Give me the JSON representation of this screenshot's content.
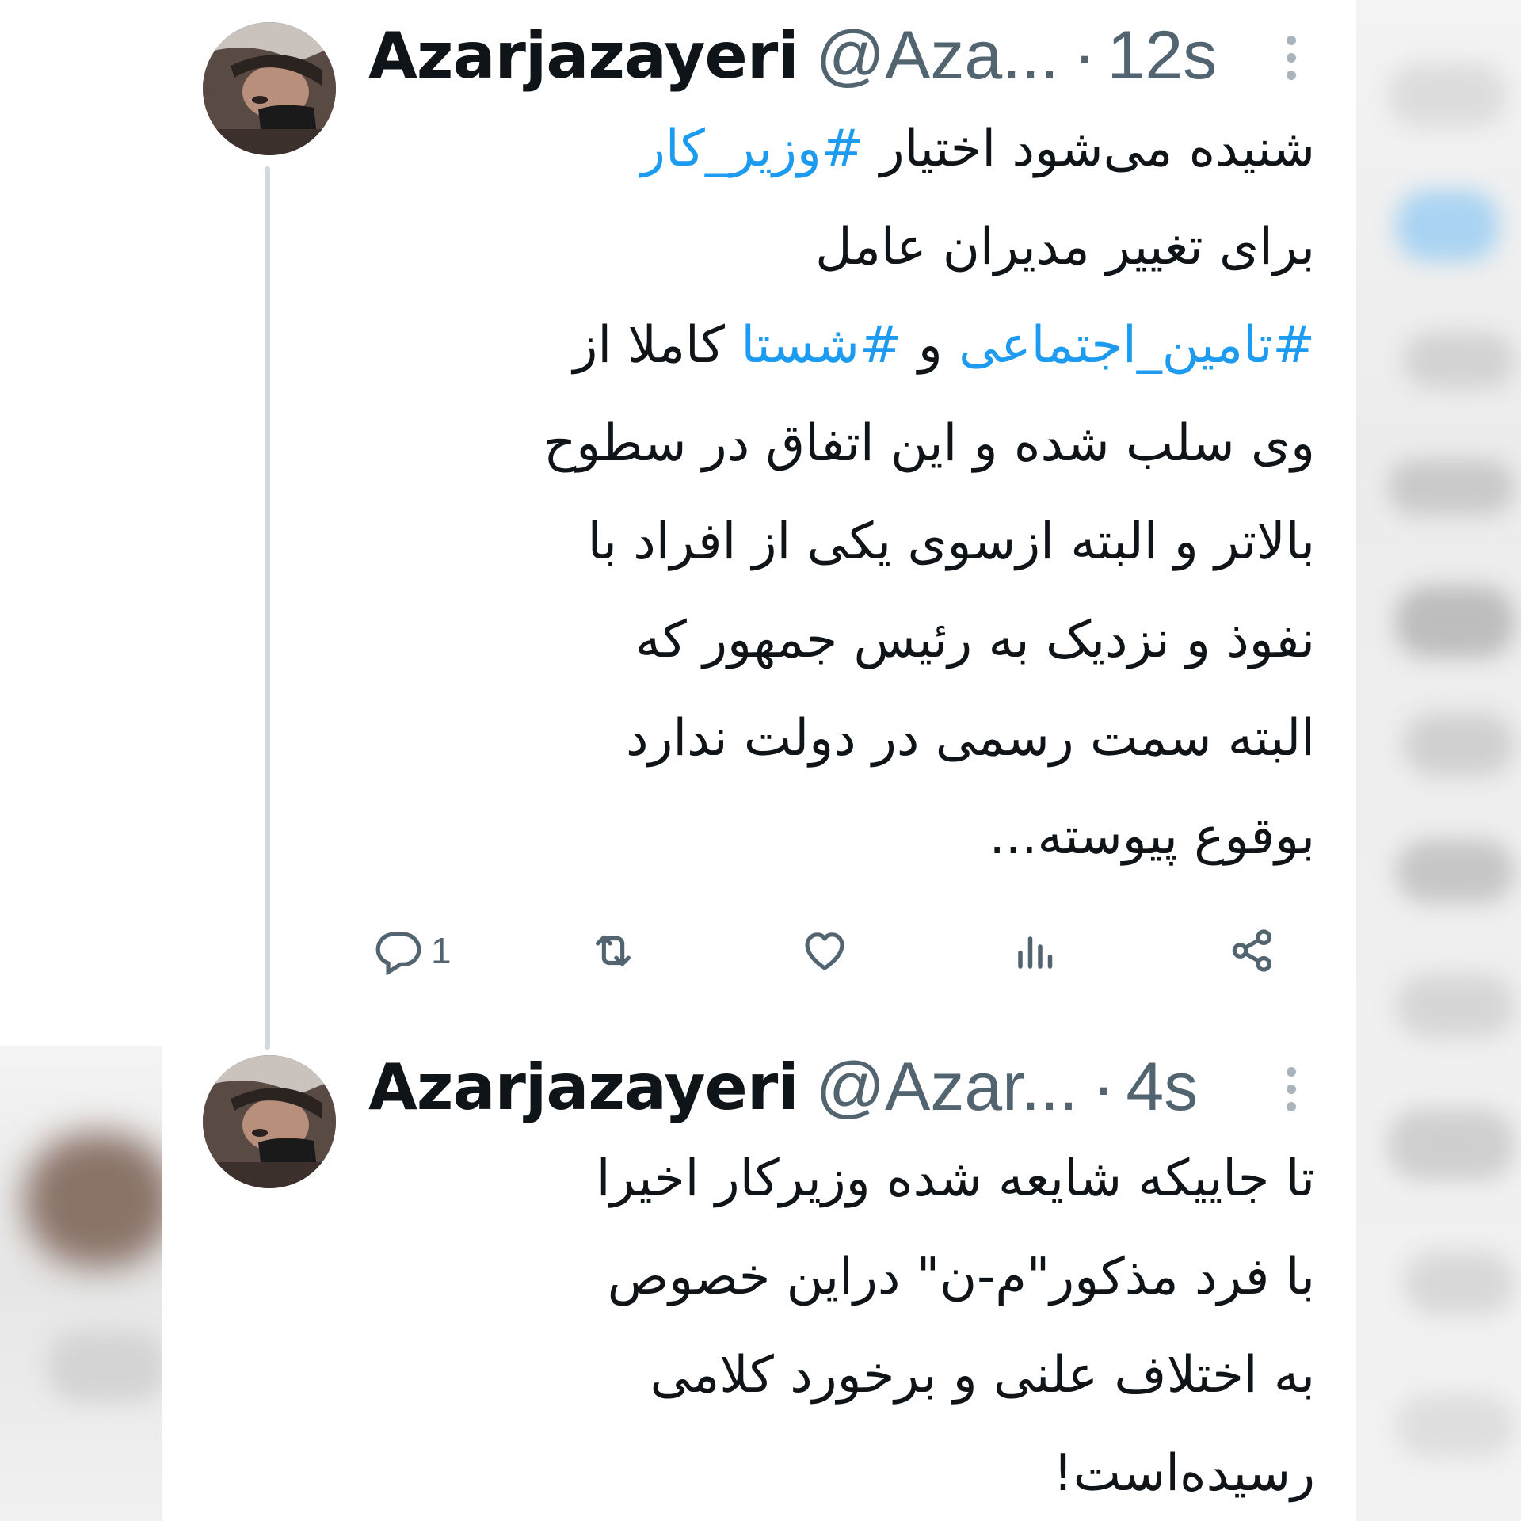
{
  "colors": {
    "text_primary": "#0f1419",
    "text_secondary": "#536471",
    "link": "#1d9bf0",
    "thread_line": "#cfd9de",
    "background": "#ffffff"
  },
  "tweets": [
    {
      "display_name": "Azarjazayeri",
      "handle": "@Aza...",
      "separator": "·",
      "time": "12s",
      "avatar_icon": "profile-photo",
      "menu_icon": "more-vertical-icon",
      "text_lines": [
        [
          {
            "text": "شنیده می‌شود اختیار ",
            "hashtag": false
          },
          {
            "text": "#وزیر_کار",
            "hashtag": true
          }
        ],
        [
          {
            "text": "برای تغییر مدیران عامل",
            "hashtag": false
          }
        ],
        [
          {
            "text": "#تامین_اجتماعی",
            "hashtag": true
          },
          {
            "text": " و ",
            "hashtag": false
          },
          {
            "text": "#شستا",
            "hashtag": true
          },
          {
            "text": " کاملا از",
            "hashtag": false
          }
        ],
        [
          {
            "text": "وی سلب شده و این اتفاق در سطوح",
            "hashtag": false
          }
        ],
        [
          {
            "text": "بالاتر و البته ازسوی یکی از افراد با",
            "hashtag": false
          }
        ],
        [
          {
            "text": "نفوذ و نزدیک به رئیس جمهور که",
            "hashtag": false
          }
        ],
        [
          {
            "text": "البته سمت رسمی در دولت ندارد",
            "hashtag": false
          }
        ],
        [
          {
            "text": "بوقوع پیوسته...",
            "hashtag": false
          }
        ]
      ],
      "actions": {
        "reply_icon": "reply-icon",
        "reply_count": "1",
        "retweet_icon": "retweet-icon",
        "like_icon": "heart-icon",
        "views_icon": "views-icon",
        "share_icon": "share-icon"
      }
    },
    {
      "display_name": "Azarjazayeri",
      "handle": "@Azar...",
      "separator": "·",
      "time": "4s",
      "avatar_icon": "profile-photo",
      "menu_icon": "more-vertical-icon",
      "text_lines": [
        [
          {
            "text": "تا جاییکه شایعه شده وزیرکار اخیرا",
            "hashtag": false
          }
        ],
        [
          {
            "text": "با فرد مذکور\"م-ن\" دراین خصوص",
            "hashtag": false
          }
        ],
        [
          {
            "text": "به اختلاف علنی و برخورد کلامی",
            "hashtag": false
          }
        ],
        [
          {
            "text": "رسیده‌است!",
            "hashtag": false
          }
        ]
      ]
    }
  ]
}
